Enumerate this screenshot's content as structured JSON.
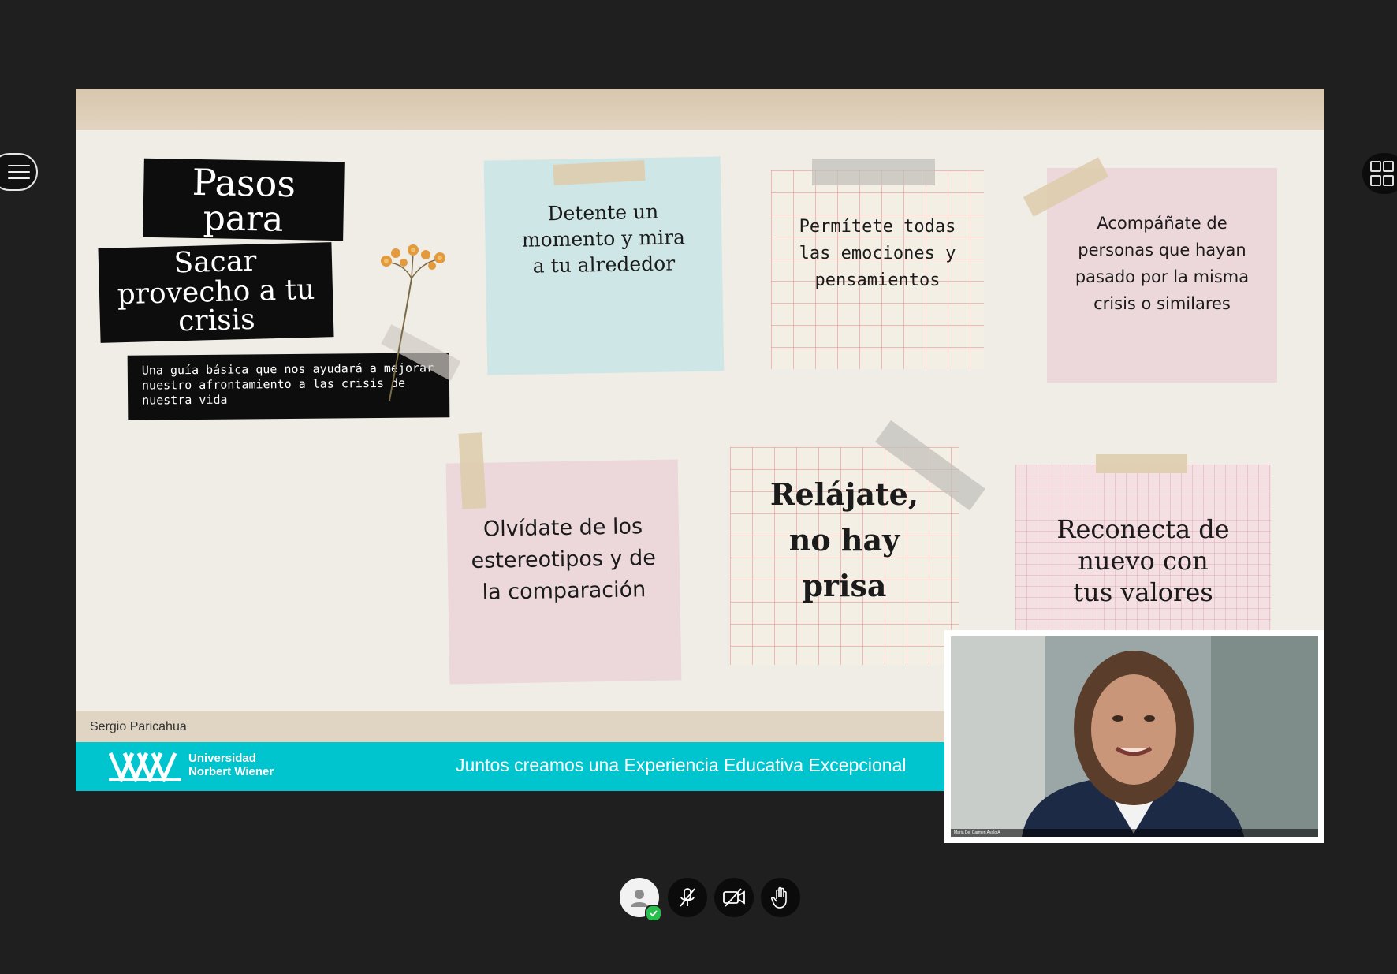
{
  "slide": {
    "title_line1": "Pasos",
    "title_line2": "para",
    "subtitle_line1": "Sacar",
    "subtitle_line2": "provecho a tu",
    "subtitle_line3": "crisis",
    "description": "Una guía básica que nos ayudará a mejorar nuestro afrontamiento a las crisis de nuestra vida",
    "notes": [
      "Detente un momento y mira a tu alrededor",
      "Permítete todas las emociones y pensamientos",
      "Acompáñate de personas que hayan pasado por la misma crisis o similares",
      "Olvídate de los estereotipos y de la comparación",
      "Relájate, no hay prisa",
      "Reconecta de nuevo con tus valores"
    ],
    "presenter_name": "Sergio Paricahua",
    "footer": {
      "university_line1": "Universidad",
      "university_line2": "Norbert Wiener",
      "slogan": "Juntos creamos una Experiencia Educativa Excepcional"
    }
  },
  "video": {
    "participant_caption": "Maria Del Carmen Avalo A"
  },
  "icons": {
    "menu": "hamburger-menu-icon",
    "layout": "grid-layout-icon",
    "user": "user-icon",
    "mic": "microphone-muted-icon",
    "camera": "camera-off-icon",
    "raise_hand": "raise-hand-icon"
  },
  "colors": {
    "background": "#1f1f1f",
    "footer_teal": "#00c5cf",
    "status_green": "#27c04e"
  }
}
